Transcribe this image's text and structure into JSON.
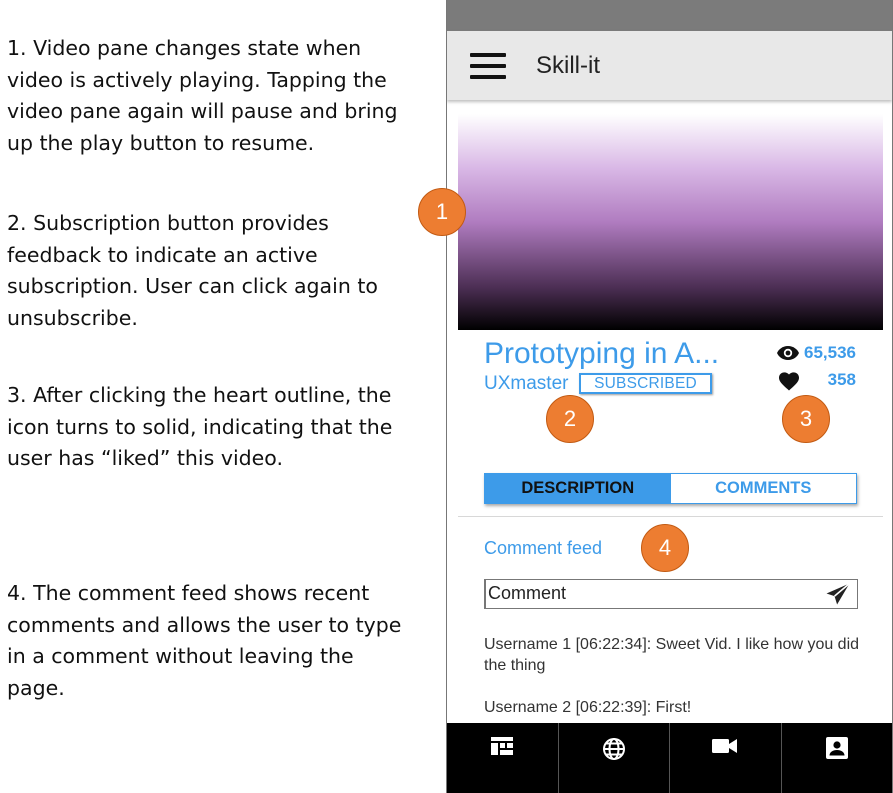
{
  "notes": [
    {
      "number": "1",
      "text": "1. Video pane changes state when video is actively playing. Tapping the video pane again will pause and bring up the play button to resume."
    },
    {
      "number": "2",
      "text": "2. Subscription button provides feedback to indicate an active subscription. User can click again to unsubscribe."
    },
    {
      "number": "3",
      "text": "3. After clicking the heart outline, the icon turns to solid, indicating that the user has “liked” this video."
    },
    {
      "number": "4",
      "text": "4. The comment feed shows recent comments and allows the user to type in a comment without leaving the page."
    }
  ],
  "callouts": [
    "1",
    "2",
    "3",
    "4"
  ],
  "colors": {
    "accent": "#3d9be9",
    "callout": "#ED7D31",
    "statusbar": "#7b7b7b",
    "appbar": "#e8e8e8",
    "nav": "#000000"
  },
  "app": {
    "title": "Skill-it",
    "menu_icon": "hamburger-icon"
  },
  "video": {
    "title": "Prototyping in A...",
    "channel": "UXmaster",
    "subscribe_label": "SUBSCRIBED",
    "views": "65,536",
    "likes": "358",
    "views_icon": "eye-icon",
    "likes_icon": "heart-solid-icon"
  },
  "tabs": [
    {
      "label": "DESCRIPTION",
      "active": true
    },
    {
      "label": "COMMENTS",
      "active": false
    }
  ],
  "comments": {
    "feed_label": "Comment feed",
    "input_placeholder": "Comment",
    "send_icon": "send-icon",
    "items": [
      "Username 1 [06:22:34]: Sweet Vid. I like how you did the thing",
      "Username 2 [06:22:39]: First!"
    ]
  },
  "bottom_nav": [
    {
      "icon": "dashboard-icon"
    },
    {
      "icon": "globe-icon"
    },
    {
      "icon": "video-camera-icon"
    },
    {
      "icon": "profile-icon"
    }
  ]
}
